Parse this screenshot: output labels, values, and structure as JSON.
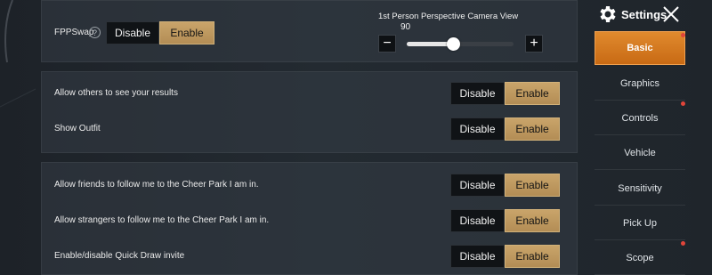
{
  "fpp": {
    "label": "FPPSwap",
    "help": "?",
    "disable": "Disable",
    "enable": "Enable",
    "selected": "Enable"
  },
  "camera": {
    "title": "1st Person Perspective Camera View",
    "value": "90",
    "minus": "−",
    "plus": "+",
    "slider_fraction": 0.43
  },
  "section1": [
    {
      "label": "Allow others to see your results",
      "disable": "Disable",
      "enable": "Enable",
      "selected": "Enable"
    },
    {
      "label": "Show Outfit",
      "disable": "Disable",
      "enable": "Enable",
      "selected": "Enable"
    }
  ],
  "section2": [
    {
      "label": "Allow friends to follow me to the Cheer Park I am in.",
      "disable": "Disable",
      "enable": "Enable",
      "selected": "Enable"
    },
    {
      "label": "Allow strangers to follow me to the Cheer Park I am in.",
      "disable": "Disable",
      "enable": "Enable",
      "selected": "Enable"
    },
    {
      "label": "Enable/disable Quick Draw invite",
      "disable": "Disable",
      "enable": "Enable",
      "selected": "Enable"
    }
  ],
  "sidebar": {
    "title": "Settings",
    "items": [
      {
        "label": "Basic",
        "active": true,
        "dot": true
      },
      {
        "label": "Graphics",
        "active": false,
        "dot": false
      },
      {
        "label": "Controls",
        "active": false,
        "dot": true
      },
      {
        "label": "Vehicle",
        "active": false,
        "dot": false
      },
      {
        "label": "Sensitivity",
        "active": false,
        "dot": false
      },
      {
        "label": "Pick Up",
        "active": false,
        "dot": false
      },
      {
        "label": "Scope",
        "active": false,
        "dot": true
      }
    ]
  },
  "colors": {
    "accent_orange": "#d97a24",
    "enable_gold": "#c29c62",
    "disable_dark": "#101316",
    "notification_dot": "#e0453a"
  }
}
